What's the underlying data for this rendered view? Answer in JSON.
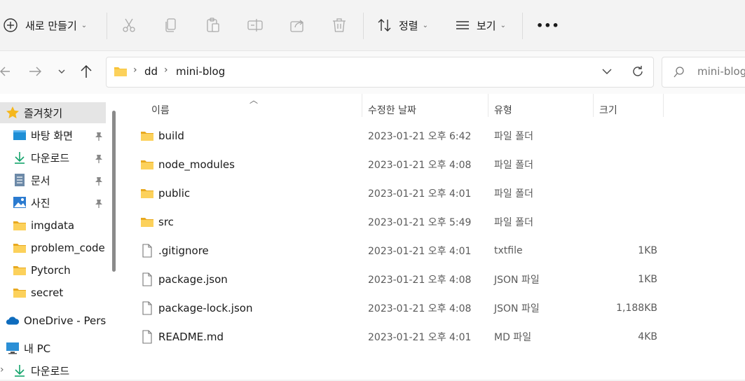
{
  "toolbar": {
    "new_label": "새로 만들기",
    "sort_label": "정렬",
    "view_label": "보기",
    "more_label": "•••"
  },
  "address": {
    "crumbs": [
      "dd",
      "mini-blog"
    ],
    "search_placeholder": "mini-blog"
  },
  "sidebar": {
    "favorites_label": "즐겨찾기",
    "items": [
      {
        "label": "바탕 화면",
        "icon": "desktop-icon",
        "pinned": true
      },
      {
        "label": "다운로드",
        "icon": "download-icon",
        "pinned": true
      },
      {
        "label": "문서",
        "icon": "document-icon",
        "pinned": true
      },
      {
        "label": "사진",
        "icon": "pictures-icon",
        "pinned": true
      },
      {
        "label": "imgdata",
        "icon": "folder-icon",
        "pinned": false
      },
      {
        "label": "problem_code",
        "icon": "folder-icon",
        "pinned": false
      },
      {
        "label": "Pytorch",
        "icon": "folder-icon",
        "pinned": false
      },
      {
        "label": "secret",
        "icon": "folder-icon",
        "pinned": false
      }
    ],
    "onedrive_label": "OneDrive - Perso",
    "pc_label": "내 PC",
    "pc_child_label": "다운로드"
  },
  "columns": {
    "name": "이름",
    "date": "수정한 날짜",
    "type": "유형",
    "size": "크기"
  },
  "files": [
    {
      "name": "build",
      "date": "2023-01-21 오후 6:42",
      "type": "파일 폴더",
      "size": "",
      "kind": "folder"
    },
    {
      "name": "node_modules",
      "date": "2023-01-21 오후 4:08",
      "type": "파일 폴더",
      "size": "",
      "kind": "folder"
    },
    {
      "name": "public",
      "date": "2023-01-21 오후 4:01",
      "type": "파일 폴더",
      "size": "",
      "kind": "folder"
    },
    {
      "name": "src",
      "date": "2023-01-21 오후 5:49",
      "type": "파일 폴더",
      "size": "",
      "kind": "folder"
    },
    {
      "name": ".gitignore",
      "date": "2023-01-21 오후 4:01",
      "type": "txtfile",
      "size": "1KB",
      "kind": "file"
    },
    {
      "name": "package.json",
      "date": "2023-01-21 오후 4:08",
      "type": "JSON 파일",
      "size": "1KB",
      "kind": "file"
    },
    {
      "name": "package-lock.json",
      "date": "2023-01-21 오후 4:08",
      "type": "JSON 파일",
      "size": "1,188KB",
      "kind": "file"
    },
    {
      "name": "README.md",
      "date": "2023-01-21 오후 4:01",
      "type": "MD 파일",
      "size": "4KB",
      "kind": "file"
    }
  ],
  "colors": {
    "folder": "#f8c43a",
    "folder_dark": "#e8a920",
    "accent": "#0f6cbd",
    "selected_bg": "#e5e5e5"
  }
}
